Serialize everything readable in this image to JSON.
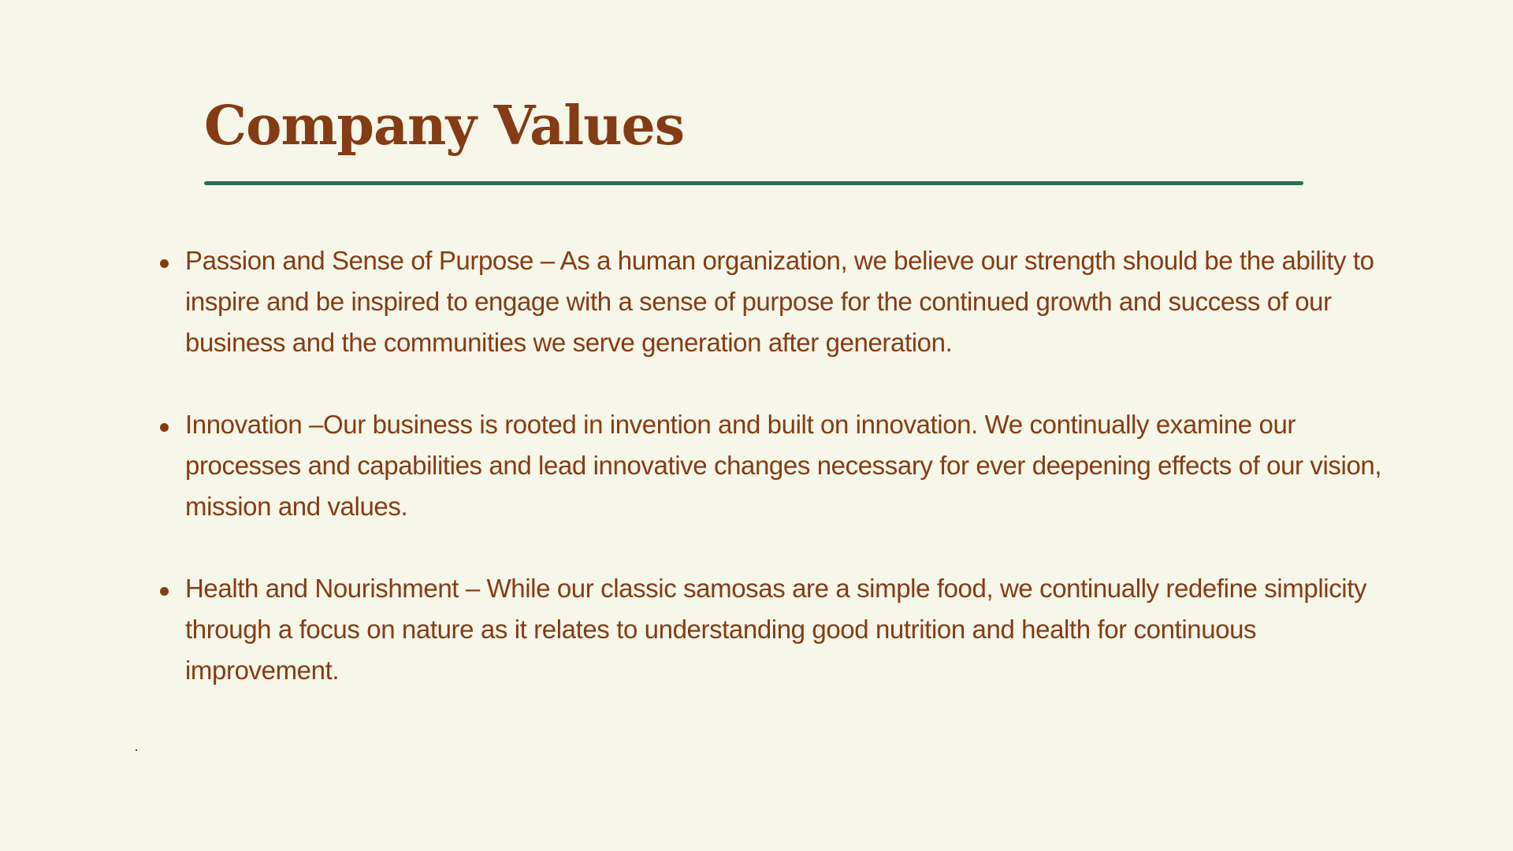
{
  "slide": {
    "title": "Company Values",
    "values": [
      {
        "text": "Passion and Sense of Purpose – As a human organization, we believe our strength should be the ability to inspire and be inspired to engage with a sense of purpose for the continued growth and success of our business and the communities we serve generation after generation."
      },
      {
        "text": "Innovation –Our business is rooted in invention and built on innovation. We continually examine our processes and capabilities and lead innovative changes necessary for ever deepening effects of our vision, mission and values."
      },
      {
        "text": "Health and Nourishment – While our classic samosas are a simple food, we continually redefine simplicity through a focus on nature as it relates to understanding good nutrition and health for continuous improvement."
      }
    ],
    "colors": {
      "background": "#f6f6e9",
      "text": "#843c14",
      "rule": "#2a6e55"
    }
  }
}
